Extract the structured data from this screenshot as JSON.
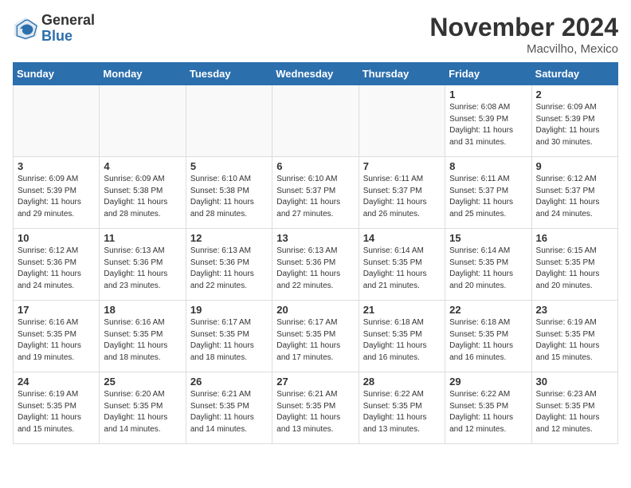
{
  "header": {
    "logo_line1": "General",
    "logo_line2": "Blue",
    "month_title": "November 2024",
    "location": "Macvilho, Mexico"
  },
  "days_of_week": [
    "Sunday",
    "Monday",
    "Tuesday",
    "Wednesday",
    "Thursday",
    "Friday",
    "Saturday"
  ],
  "weeks": [
    [
      {
        "day": "",
        "info": ""
      },
      {
        "day": "",
        "info": ""
      },
      {
        "day": "",
        "info": ""
      },
      {
        "day": "",
        "info": ""
      },
      {
        "day": "",
        "info": ""
      },
      {
        "day": "1",
        "info": "Sunrise: 6:08 AM\nSunset: 5:39 PM\nDaylight: 11 hours and 31 minutes."
      },
      {
        "day": "2",
        "info": "Sunrise: 6:09 AM\nSunset: 5:39 PM\nDaylight: 11 hours and 30 minutes."
      }
    ],
    [
      {
        "day": "3",
        "info": "Sunrise: 6:09 AM\nSunset: 5:39 PM\nDaylight: 11 hours and 29 minutes."
      },
      {
        "day": "4",
        "info": "Sunrise: 6:09 AM\nSunset: 5:38 PM\nDaylight: 11 hours and 28 minutes."
      },
      {
        "day": "5",
        "info": "Sunrise: 6:10 AM\nSunset: 5:38 PM\nDaylight: 11 hours and 28 minutes."
      },
      {
        "day": "6",
        "info": "Sunrise: 6:10 AM\nSunset: 5:37 PM\nDaylight: 11 hours and 27 minutes."
      },
      {
        "day": "7",
        "info": "Sunrise: 6:11 AM\nSunset: 5:37 PM\nDaylight: 11 hours and 26 minutes."
      },
      {
        "day": "8",
        "info": "Sunrise: 6:11 AM\nSunset: 5:37 PM\nDaylight: 11 hours and 25 minutes."
      },
      {
        "day": "9",
        "info": "Sunrise: 6:12 AM\nSunset: 5:37 PM\nDaylight: 11 hours and 24 minutes."
      }
    ],
    [
      {
        "day": "10",
        "info": "Sunrise: 6:12 AM\nSunset: 5:36 PM\nDaylight: 11 hours and 24 minutes."
      },
      {
        "day": "11",
        "info": "Sunrise: 6:13 AM\nSunset: 5:36 PM\nDaylight: 11 hours and 23 minutes."
      },
      {
        "day": "12",
        "info": "Sunrise: 6:13 AM\nSunset: 5:36 PM\nDaylight: 11 hours and 22 minutes."
      },
      {
        "day": "13",
        "info": "Sunrise: 6:13 AM\nSunset: 5:36 PM\nDaylight: 11 hours and 22 minutes."
      },
      {
        "day": "14",
        "info": "Sunrise: 6:14 AM\nSunset: 5:35 PM\nDaylight: 11 hours and 21 minutes."
      },
      {
        "day": "15",
        "info": "Sunrise: 6:14 AM\nSunset: 5:35 PM\nDaylight: 11 hours and 20 minutes."
      },
      {
        "day": "16",
        "info": "Sunrise: 6:15 AM\nSunset: 5:35 PM\nDaylight: 11 hours and 20 minutes."
      }
    ],
    [
      {
        "day": "17",
        "info": "Sunrise: 6:16 AM\nSunset: 5:35 PM\nDaylight: 11 hours and 19 minutes."
      },
      {
        "day": "18",
        "info": "Sunrise: 6:16 AM\nSunset: 5:35 PM\nDaylight: 11 hours and 18 minutes."
      },
      {
        "day": "19",
        "info": "Sunrise: 6:17 AM\nSunset: 5:35 PM\nDaylight: 11 hours and 18 minutes."
      },
      {
        "day": "20",
        "info": "Sunrise: 6:17 AM\nSunset: 5:35 PM\nDaylight: 11 hours and 17 minutes."
      },
      {
        "day": "21",
        "info": "Sunrise: 6:18 AM\nSunset: 5:35 PM\nDaylight: 11 hours and 16 minutes."
      },
      {
        "day": "22",
        "info": "Sunrise: 6:18 AM\nSunset: 5:35 PM\nDaylight: 11 hours and 16 minutes."
      },
      {
        "day": "23",
        "info": "Sunrise: 6:19 AM\nSunset: 5:35 PM\nDaylight: 11 hours and 15 minutes."
      }
    ],
    [
      {
        "day": "24",
        "info": "Sunrise: 6:19 AM\nSunset: 5:35 PM\nDaylight: 11 hours and 15 minutes."
      },
      {
        "day": "25",
        "info": "Sunrise: 6:20 AM\nSunset: 5:35 PM\nDaylight: 11 hours and 14 minutes."
      },
      {
        "day": "26",
        "info": "Sunrise: 6:21 AM\nSunset: 5:35 PM\nDaylight: 11 hours and 14 minutes."
      },
      {
        "day": "27",
        "info": "Sunrise: 6:21 AM\nSunset: 5:35 PM\nDaylight: 11 hours and 13 minutes."
      },
      {
        "day": "28",
        "info": "Sunrise: 6:22 AM\nSunset: 5:35 PM\nDaylight: 11 hours and 13 minutes."
      },
      {
        "day": "29",
        "info": "Sunrise: 6:22 AM\nSunset: 5:35 PM\nDaylight: 11 hours and 12 minutes."
      },
      {
        "day": "30",
        "info": "Sunrise: 6:23 AM\nSunset: 5:35 PM\nDaylight: 11 hours and 12 minutes."
      }
    ]
  ]
}
